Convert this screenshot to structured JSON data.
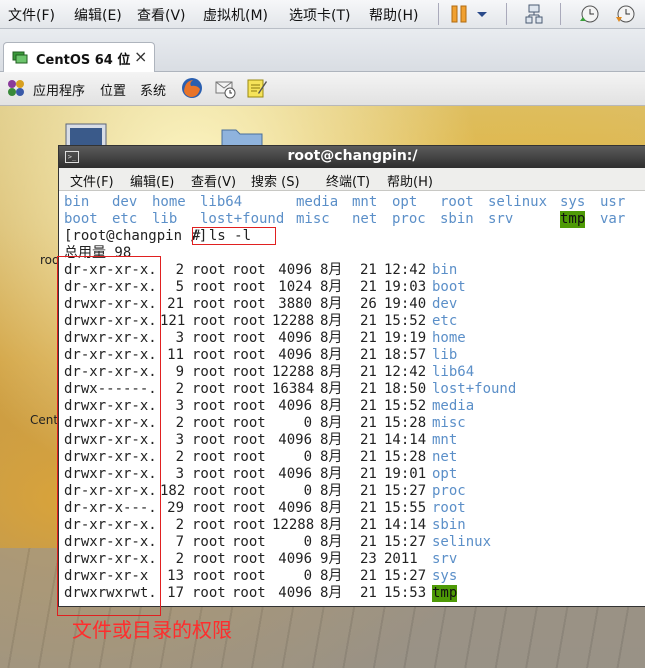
{
  "menubar": {
    "items": [
      "文件(F)",
      "编辑(E)",
      "查看(V)",
      "虚拟机(M)",
      "选项卡(T)",
      "帮助(H)"
    ]
  },
  "tabs": [
    {
      "label": "CentOS 64 位",
      "close": "×"
    }
  ],
  "panel": {
    "items": [
      "应用程序",
      "位置",
      "系统"
    ]
  },
  "desktop": {
    "label_root": "roo",
    "label_cent": "Cent"
  },
  "terminal": {
    "title": "root@changpin:/",
    "menu": [
      "文件(F)",
      "编辑(E)",
      "查看(V)",
      "搜索 (S)",
      "终端(T)",
      "帮助(H)"
    ],
    "ls_row1": [
      "bin",
      "dev",
      "home",
      "lib64",
      "media",
      "mnt",
      "opt",
      "root",
      "selinux",
      "sys",
      "usr"
    ],
    "ls_row2": [
      "boot",
      "etc",
      "lib",
      "lost+found",
      "misc",
      "net",
      "proc",
      "sbin",
      "srv",
      "tmp",
      "var"
    ],
    "prompt": "[root@changpin /]",
    "command": "# ls -l",
    "total": "总用量 98",
    "listing": [
      {
        "perm": "dr-xr-xr-x.",
        "links": "2",
        "owner": "root",
        "group": "root",
        "size": "4096",
        "month": "8月",
        "day": "21",
        "time": "12:42",
        "name": "bin"
      },
      {
        "perm": "dr-xr-xr-x.",
        "links": "5",
        "owner": "root",
        "group": "root",
        "size": "1024",
        "month": "8月",
        "day": "21",
        "time": "19:03",
        "name": "boot"
      },
      {
        "perm": "drwxr-xr-x.",
        "links": "21",
        "owner": "root",
        "group": "root",
        "size": "3880",
        "month": "8月",
        "day": "26",
        "time": "19:40",
        "name": "dev"
      },
      {
        "perm": "drwxr-xr-x.",
        "links": "121",
        "owner": "root",
        "group": "root",
        "size": "12288",
        "month": "8月",
        "day": "21",
        "time": "15:52",
        "name": "etc"
      },
      {
        "perm": "drwxr-xr-x.",
        "links": "3",
        "owner": "root",
        "group": "root",
        "size": "4096",
        "month": "8月",
        "day": "21",
        "time": "19:19",
        "name": "home"
      },
      {
        "perm": "dr-xr-xr-x.",
        "links": "11",
        "owner": "root",
        "group": "root",
        "size": "4096",
        "month": "8月",
        "day": "21",
        "time": "18:57",
        "name": "lib"
      },
      {
        "perm": "dr-xr-xr-x.",
        "links": "9",
        "owner": "root",
        "group": "root",
        "size": "12288",
        "month": "8月",
        "day": "21",
        "time": "12:42",
        "name": "lib64"
      },
      {
        "perm": "drwx------.",
        "links": "2",
        "owner": "root",
        "group": "root",
        "size": "16384",
        "month": "8月",
        "day": "21",
        "time": "18:50",
        "name": "lost+found"
      },
      {
        "perm": "drwxr-xr-x.",
        "links": "3",
        "owner": "root",
        "group": "root",
        "size": "4096",
        "month": "8月",
        "day": "21",
        "time": "15:52",
        "name": "media"
      },
      {
        "perm": "drwxr-xr-x.",
        "links": "2",
        "owner": "root",
        "group": "root",
        "size": "0",
        "month": "8月",
        "day": "21",
        "time": "15:28",
        "name": "misc"
      },
      {
        "perm": "drwxr-xr-x.",
        "links": "3",
        "owner": "root",
        "group": "root",
        "size": "4096",
        "month": "8月",
        "day": "21",
        "time": "14:14",
        "name": "mnt"
      },
      {
        "perm": "drwxr-xr-x.",
        "links": "2",
        "owner": "root",
        "group": "root",
        "size": "0",
        "month": "8月",
        "day": "21",
        "time": "15:28",
        "name": "net"
      },
      {
        "perm": "drwxr-xr-x.",
        "links": "3",
        "owner": "root",
        "group": "root",
        "size": "4096",
        "month": "8月",
        "day": "21",
        "time": "19:01",
        "name": "opt"
      },
      {
        "perm": "dr-xr-xr-x.",
        "links": "182",
        "owner": "root",
        "group": "root",
        "size": "0",
        "month": "8月",
        "day": "21",
        "time": "15:27",
        "name": "proc"
      },
      {
        "perm": "dr-xr-x---.",
        "links": "29",
        "owner": "root",
        "group": "root",
        "size": "4096",
        "month": "8月",
        "day": "21",
        "time": "15:55",
        "name": "root"
      },
      {
        "perm": "dr-xr-xr-x.",
        "links": "2",
        "owner": "root",
        "group": "root",
        "size": "12288",
        "month": "8月",
        "day": "21",
        "time": "14:14",
        "name": "sbin"
      },
      {
        "perm": "drwxr-xr-x.",
        "links": "7",
        "owner": "root",
        "group": "root",
        "size": "0",
        "month": "8月",
        "day": "21",
        "time": "15:27",
        "name": "selinux"
      },
      {
        "perm": "drwxr-xr-x.",
        "links": "2",
        "owner": "root",
        "group": "root",
        "size": "4096",
        "month": "9月",
        "day": "23",
        "time": "2011",
        "name": "srv"
      },
      {
        "perm": "drwxr-xr-x",
        "links": "13",
        "owner": "root",
        "group": "root",
        "size": "0",
        "month": "8月",
        "day": "21",
        "time": "15:27",
        "name": "sys"
      },
      {
        "perm": "drwxrwxrwt.",
        "links": "17",
        "owner": "root",
        "group": "root",
        "size": "4096",
        "month": "8月",
        "day": "21",
        "time": "15:53",
        "name": "tmp"
      }
    ]
  },
  "annotation": "文件或目录的权限",
  "colors": {
    "dir": "#5b8fc8",
    "highlight_bg": "#4e9a06",
    "annotation": "#ff2d2d"
  }
}
